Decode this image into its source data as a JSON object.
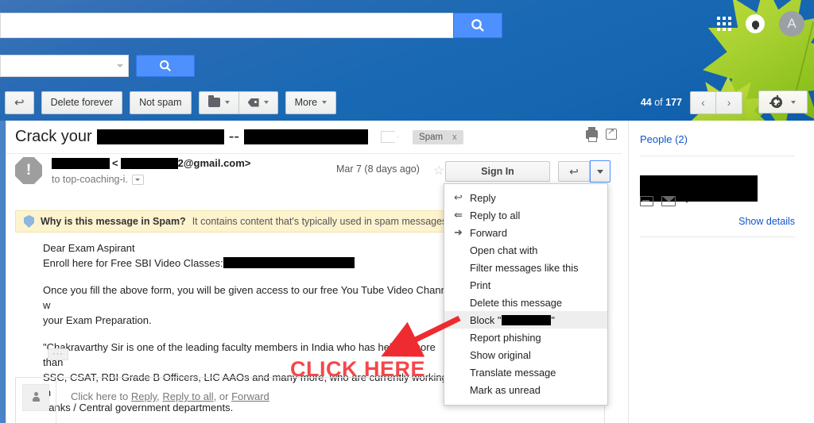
{
  "header": {
    "search_value": "",
    "search_placeholder": "",
    "search_button_icon": "search-icon",
    "secondary_search_value": "",
    "secondary_search_button_icon": "search-icon",
    "apps_icon": "apps-grid-icon",
    "notifications_icon": "bell-icon",
    "avatar_letter": "A"
  },
  "toolbar": {
    "back_label": "↩",
    "delete_forever": "Delete forever",
    "not_spam": "Not spam",
    "move_to_icon": "folder-icon",
    "labels_icon": "tag-icon",
    "more_label": "More",
    "pager_current": "44",
    "pager_of": "of",
    "pager_total": "177",
    "prev_label": "‹",
    "next_label": "›",
    "settings_icon": "gear-icon"
  },
  "email": {
    "subject_prefix": "Crack your",
    "subject_redacted_1": "",
    "subject_separator": "--",
    "subject_redacted_2": "",
    "label_chip": "Spam",
    "label_chip_remove": "x",
    "print_icon": "printer-icon",
    "popout_icon": "open-in-new-window-icon",
    "warning_icon": "!",
    "sender_name_redacted": "",
    "sender_email_open": "<",
    "sender_email_redacted": "",
    "sender_email_domain": "2@gmail.com>",
    "recipient": "to top-coaching-i.",
    "date": "Mar 7 (8 days ago)",
    "star_icon": "star-outline-icon",
    "sign_in_label": "Sign In",
    "reply_icon": "reply-arrow-icon",
    "more_options_icon": "chevron-down-icon"
  },
  "spam_banner": {
    "question": "Why is this message in Spam?",
    "explanation": "It contains content that's typically used in spam messages",
    "shield_icon": "shield-icon"
  },
  "body": {
    "p1_line1": "Dear Exam Aspirant",
    "p1_line2": "Enroll here for Free SBI Video Classes:",
    "p2": "Once you fill the above form, you will be given access to our free You Tube Video Channel w",
    "p2b": "your Exam Preparation.",
    "p3_line1": "\"Chakravarthy Sir is one of the leading faculty members in India who has helped more than",
    "p3_line2": "SSC, CSAT, RBI Grade B Officers, LIC AAOs and many more, who are currently working in",
    "p3_line3": "banks / Central government departments.",
    "trimmed_button": "···"
  },
  "menu": {
    "items": [
      {
        "label": "Reply",
        "icon": "reply-arrow-icon",
        "glyph": "↰",
        "highlighted": false
      },
      {
        "label": "Reply to all",
        "icon": "reply-all-arrow-icon",
        "glyph": "↰",
        "highlighted": false
      },
      {
        "label": "Forward",
        "icon": "forward-arrow-icon",
        "glyph": "➜",
        "highlighted": false
      },
      {
        "label": "Open chat with",
        "icon": "",
        "glyph": "",
        "highlighted": false
      },
      {
        "label": "Filter messages like this",
        "icon": "",
        "glyph": "",
        "highlighted": false
      },
      {
        "label": "Print",
        "icon": "",
        "glyph": "",
        "highlighted": false
      },
      {
        "label": "Delete this message",
        "icon": "",
        "glyph": "",
        "highlighted": false
      },
      {
        "label": "Block \"",
        "icon": "",
        "glyph": "",
        "highlighted": true,
        "redacted": true,
        "label_suffix": "\""
      },
      {
        "label": "Report phishing",
        "icon": "",
        "glyph": "",
        "highlighted": false
      },
      {
        "label": "Show original",
        "icon": "",
        "glyph": "",
        "highlighted": false
      },
      {
        "label": "Translate message",
        "icon": "",
        "glyph": "",
        "highlighted": false
      },
      {
        "label": "Mark as unread",
        "icon": "",
        "glyph": "",
        "highlighted": false
      }
    ]
  },
  "reply_box": {
    "prefix": "Click here to ",
    "reply": "Reply",
    "comma": ", ",
    "reply_all": "Reply to all",
    "or": ", or ",
    "forward": "Forward",
    "avatar_icon": "person-icon"
  },
  "people_panel": {
    "title": "People (2)",
    "contact_redacted": "",
    "contact_email": "",
    "archive_icon": "archive-icon",
    "mail_icon": "envelope-icon",
    "caret_icon": "chevron-down-icon",
    "show_details": "Show details"
  },
  "annotation": {
    "text": "CLICK HERE",
    "color": "#f4474b",
    "arrow_icon": "red-arrow-icon"
  },
  "colors": {
    "chrome_blue": "#1a69b4",
    "accent_blue": "#4d90fe",
    "link_blue": "#1155cc",
    "spam_banner_bg": "#fdf3ce",
    "annotation_red": "#f4474b",
    "leaf_green": "#a8d02b"
  }
}
